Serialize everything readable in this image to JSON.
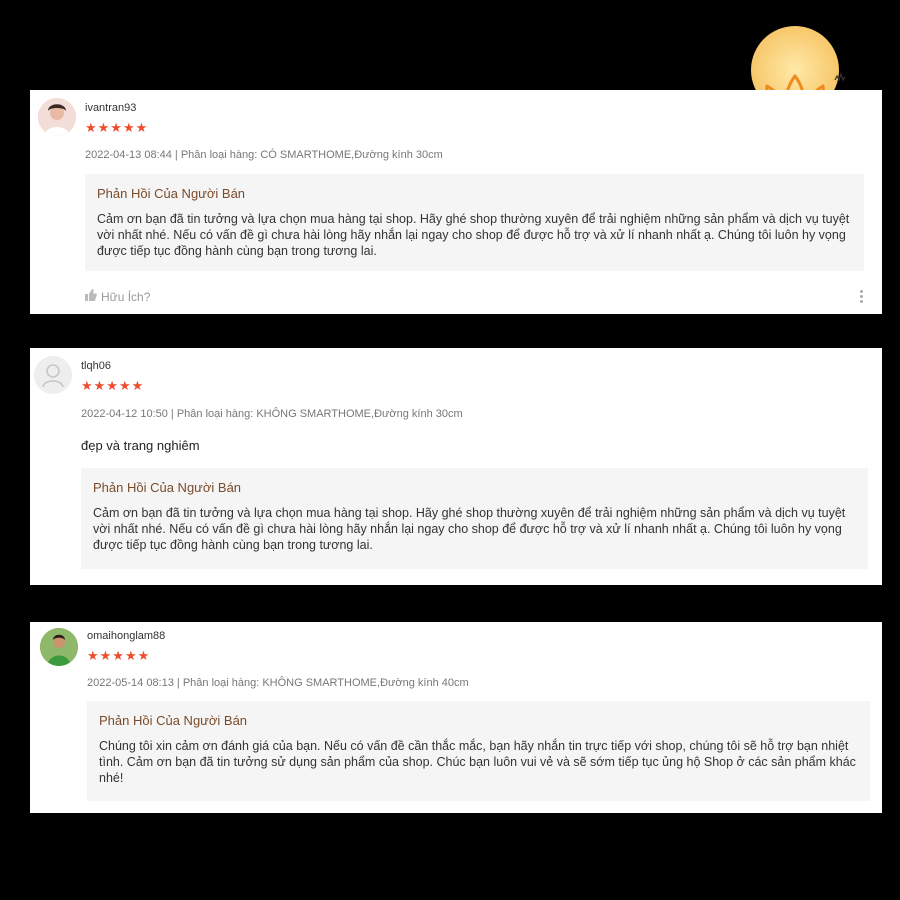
{
  "reviews": [
    {
      "username": "ivantran93",
      "stars": "★★★★★",
      "meta": "2022-04-13 08:44 | Phân loại hàng: CÓ SMARTHOME,Đường kính 30cm",
      "reply_title": "Phản Hồi Của Người Bán",
      "reply_text": "Cảm ơn bạn đã tin tưởng và lựa chọn mua hàng tại shop. Hãy ghé shop thường xuyên để trải nghiệm những sản phẩm và dịch vụ tuyệt vời nhất nhé. Nếu có vấn đề gì chưa hài lòng hãy nhắn lại ngay cho shop để được hỗ trợ và xử lí nhanh nhất ạ. Chúng tôi luôn hy vọng được tiếp tục đồng hành cùng bạn trong tương lai.",
      "helpful_label": "Hữu Ích?"
    },
    {
      "username": "tlqh06",
      "stars": "★★★★★",
      "meta": "2022-04-12 10:50 | Phân loại hàng: KHÔNG SMARTHOME,Đường kính 30cm",
      "comment": "đẹp và trang nghiêm",
      "reply_title": "Phản Hồi Của Người Bán",
      "reply_text": "Cảm ơn bạn đã tin tưởng và lựa chọn mua hàng tại shop. Hãy ghé shop thường xuyên để trải nghiệm những sản phẩm và dịch vụ tuyệt vời nhất nhé. Nếu có vấn đề gì chưa hài lòng hãy nhắn lại ngay cho shop để được hỗ trợ và xử lí nhanh nhất ạ. Chúng tôi luôn hy vọng được tiếp tục đồng hành cùng bạn trong tương lai."
    },
    {
      "username": "omaihonglam88",
      "stars": "★★★★★",
      "meta": "2022-05-14 08:13 | Phân loại hàng: KHÔNG SMARTHOME,Đường kính 40cm",
      "reply_title": "Phản Hồi Của Người Bán",
      "reply_text": "Chúng tôi  xin cảm ơn đánh giá của bạn. Nếu có vấn đề cần thắc mắc, bạn hãy nhắn tin trực tiếp với shop, chúng tôi sẽ hỗ trợ bạn nhiệt tình. Cảm ơn bạn đã tin tưởng sử dụng sản phẩm của shop. Chúc bạn luôn vui vẻ và sẽ sớm tiếp tục ủng hộ Shop ở các sản phẩm khác nhé!"
    }
  ],
  "colors": {
    "star": "#ee4d2d",
    "reply_title": "#7a4b2a",
    "reply_bg": "#f5f5f5",
    "logo_orange": "#f5a623"
  },
  "icons": [
    "thumbs-up-icon",
    "more-vertical-icon",
    "default-avatar-icon",
    "lotus-logo-icon"
  ]
}
